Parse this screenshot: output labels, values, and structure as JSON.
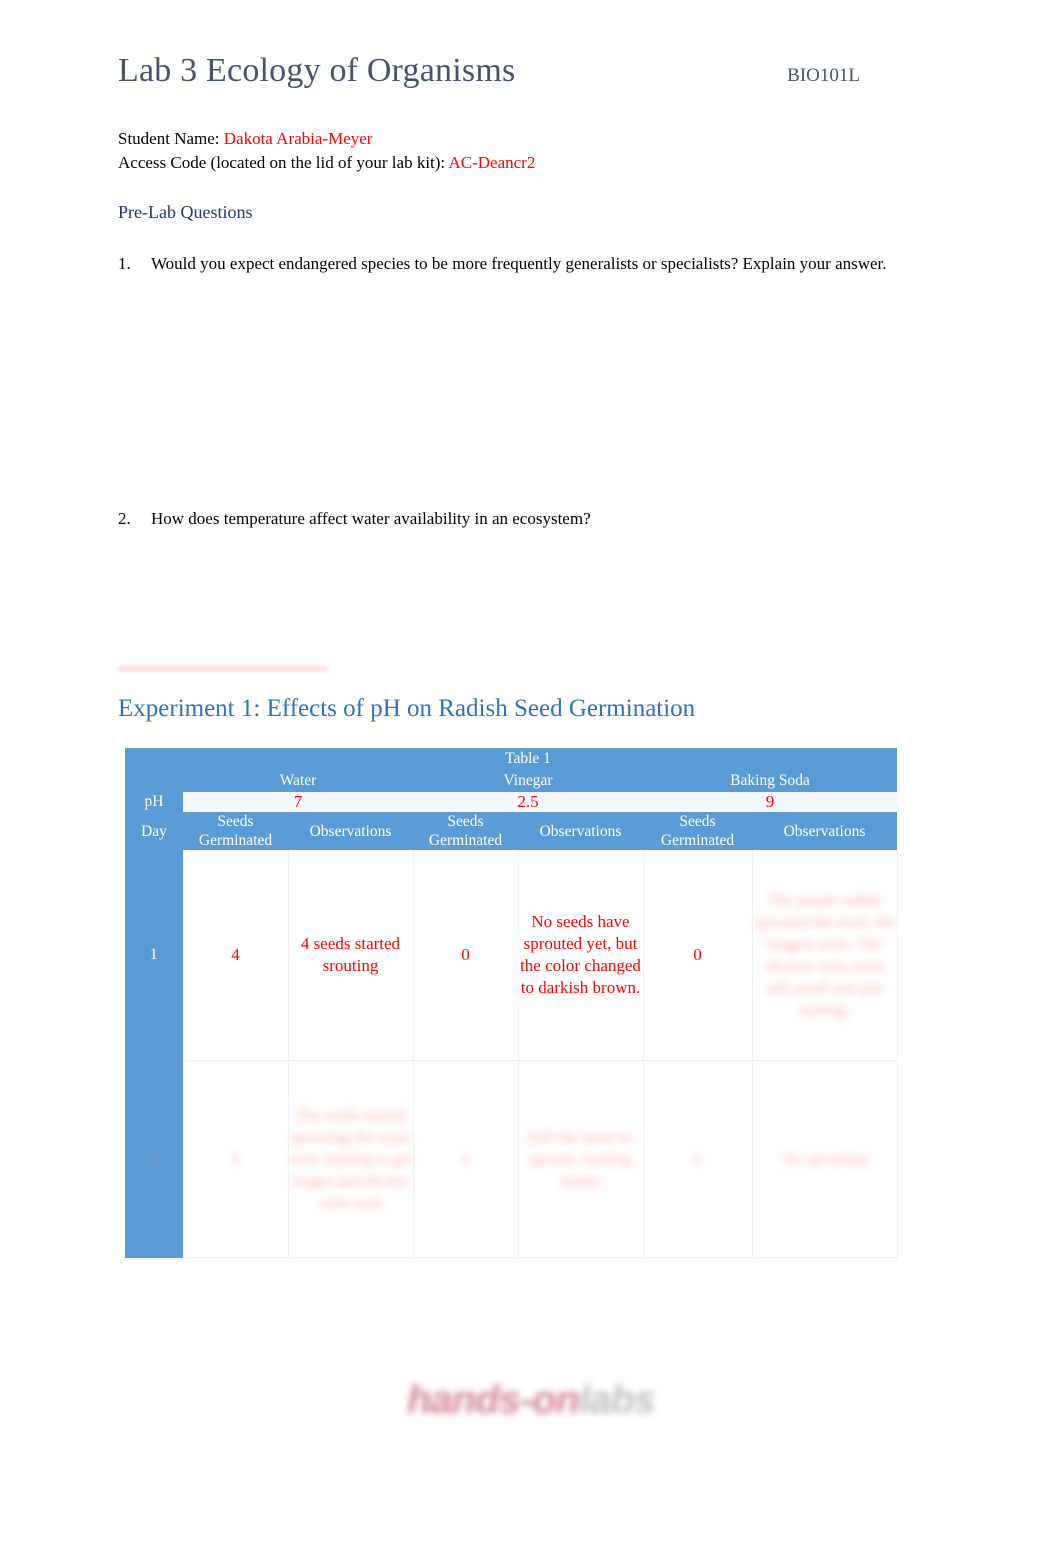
{
  "document": {
    "title": "Lab 3 Ecology of Organisms",
    "course_code": "BIO101L"
  },
  "identity": {
    "student_name_label": "Student Name:",
    "student_name_value": "Dakota Arabia-Meyer",
    "access_code_label": "Access Code (located on the lid of your lab kit):",
    "access_code_value": "AC-Deancr2"
  },
  "prelab": {
    "heading": "Pre-Lab Questions",
    "questions": [
      {
        "number": "1.",
        "text": "Would you expect endangered species to be more frequently generalists or specialists? Explain your answer.",
        "answer": ""
      },
      {
        "number": "2.",
        "text": "How does temperature affect water availability in an ecosystem?",
        "answer": ""
      }
    ]
  },
  "experiment": {
    "heading": "Experiment 1: Effects of pH on Radish Seed Germination"
  },
  "table": {
    "caption": "Table 1",
    "treatments": [
      {
        "name": "Water",
        "ph": "7"
      },
      {
        "name": "Vinegar",
        "ph": "2.5"
      },
      {
        "name": "Baking Soda",
        "ph": "9"
      }
    ],
    "ph_label": "pH",
    "day_label": "Day",
    "column_headers": {
      "seeds_germinated": "Seeds Germinated",
      "observations": "Observations"
    },
    "rows": [
      {
        "day": "1",
        "water_seeds": "4",
        "water_observations": "4 seeds started srouting",
        "vinegar_seeds": "0",
        "vinegar_observations": "No seeds have sprouted yet, but the color changed to darkish brown.",
        "baking_soda_seeds": "0",
        "baking_soda_observations": "[illegible — blurred handwriting]"
      },
      {
        "day": "[blurred]",
        "water_seeds": "[blurred]",
        "water_observations": "[illegible — blurred handwriting]",
        "vinegar_seeds": "[blurred]",
        "vinegar_observations": "[illegible — blurred handwriting]",
        "baking_soda_seeds": "[blurred]",
        "baking_soda_observations": "[illegible — blurred handwriting]"
      }
    ]
  },
  "footer": {
    "watermark_primary": "hands-on",
    "watermark_secondary": "labs"
  },
  "colors": {
    "title_blue": "#44546A",
    "heading_blue": "#2E74B5",
    "prelab_blue": "#1F3864",
    "table_blue": "#5B9BD5",
    "answer_red": "#FF0000"
  }
}
